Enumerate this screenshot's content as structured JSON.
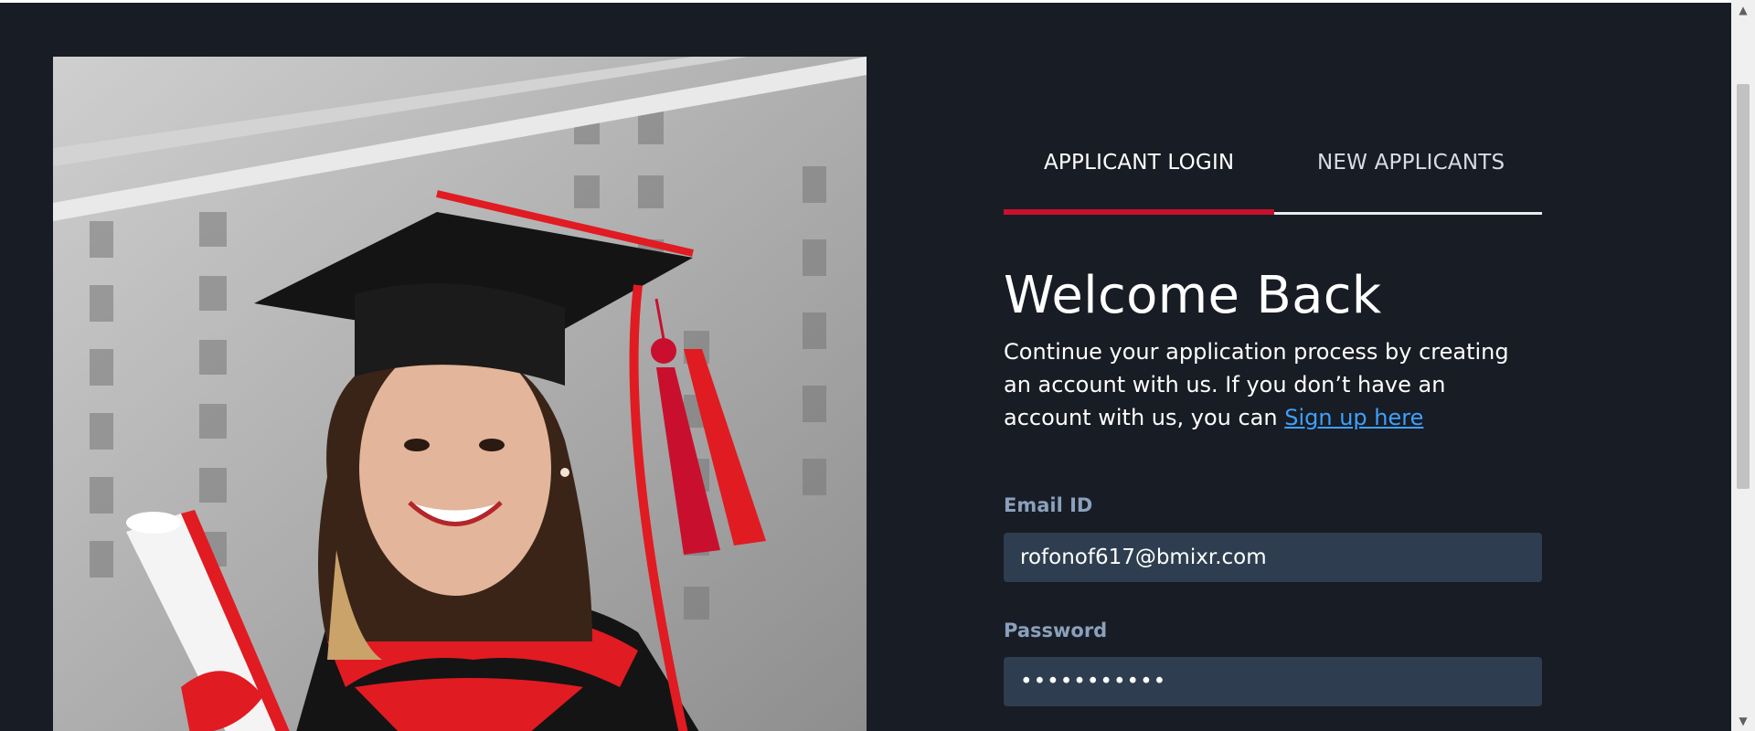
{
  "tabs": {
    "login_label": "APPLICANT LOGIN",
    "new_label": "NEW APPLICANTS"
  },
  "welcome": {
    "heading": "Welcome Back",
    "intro_text": "Continue your application process by creating an account with us. If you don’t have an account with us, you can ",
    "signup_link": "Sign up here"
  },
  "form": {
    "email_label": "Email ID",
    "email_value": "rofonof617@bmixr.com",
    "password_label": "Password",
    "password_value": "•••••••••••"
  },
  "colors": {
    "page_bg": "#181c24",
    "accent_red": "#c8102e",
    "link_blue": "#3ea0ff",
    "field_bg": "#2e3e50",
    "label_color": "#8aa0bc"
  },
  "icons": {
    "scroll_up": "▲",
    "scroll_down": "▼"
  }
}
